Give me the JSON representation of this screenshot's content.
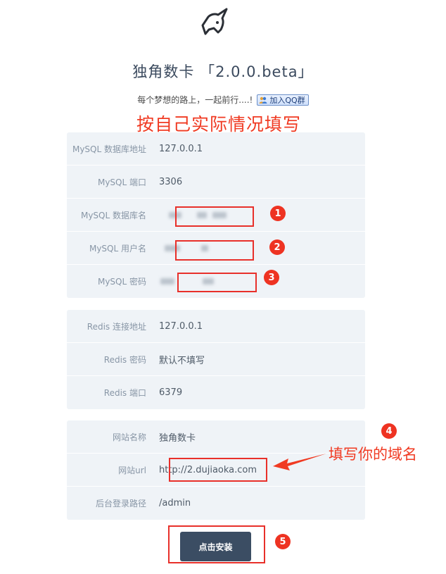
{
  "header": {
    "title": "独角数卡 「2.0.0.beta」",
    "subtitle": "每个梦想的路上，一起前行....!",
    "qq_group_label": "加入QQ群"
  },
  "annotations": {
    "top_note": "按自己实际情况填写",
    "domain_note": "填写你的域名",
    "badges": [
      "1",
      "2",
      "3",
      "4",
      "5"
    ],
    "highlight_color": "#e8302a"
  },
  "mysql": {
    "host_label": "MySQL 数据库地址",
    "host_value": "127.0.0.1",
    "port_label": "MySQL 端口",
    "port_value": "3306",
    "db_label": "MySQL 数据库名",
    "user_label": "MySQL 用户名",
    "password_label": "MySQL 密码"
  },
  "redis": {
    "host_label": "Redis 连接地址",
    "host_value": "127.0.0.1",
    "password_label": "Redis 密码",
    "password_placeholder": "默认不填写",
    "port_label": "Redis 端口",
    "port_value": "6379"
  },
  "site": {
    "name_label": "网站名称",
    "name_value": "独角数卡",
    "url_label": "网站url",
    "url_value": "http://2.dujiaoka.com",
    "admin_path_label": "后台登录路径",
    "admin_path_value": "/admin"
  },
  "actions": {
    "install_label": "点击安装"
  },
  "colors": {
    "card_bg": "#eff3f7",
    "button_bg": "#3b4d63",
    "annotation_red": "#f03a22"
  }
}
